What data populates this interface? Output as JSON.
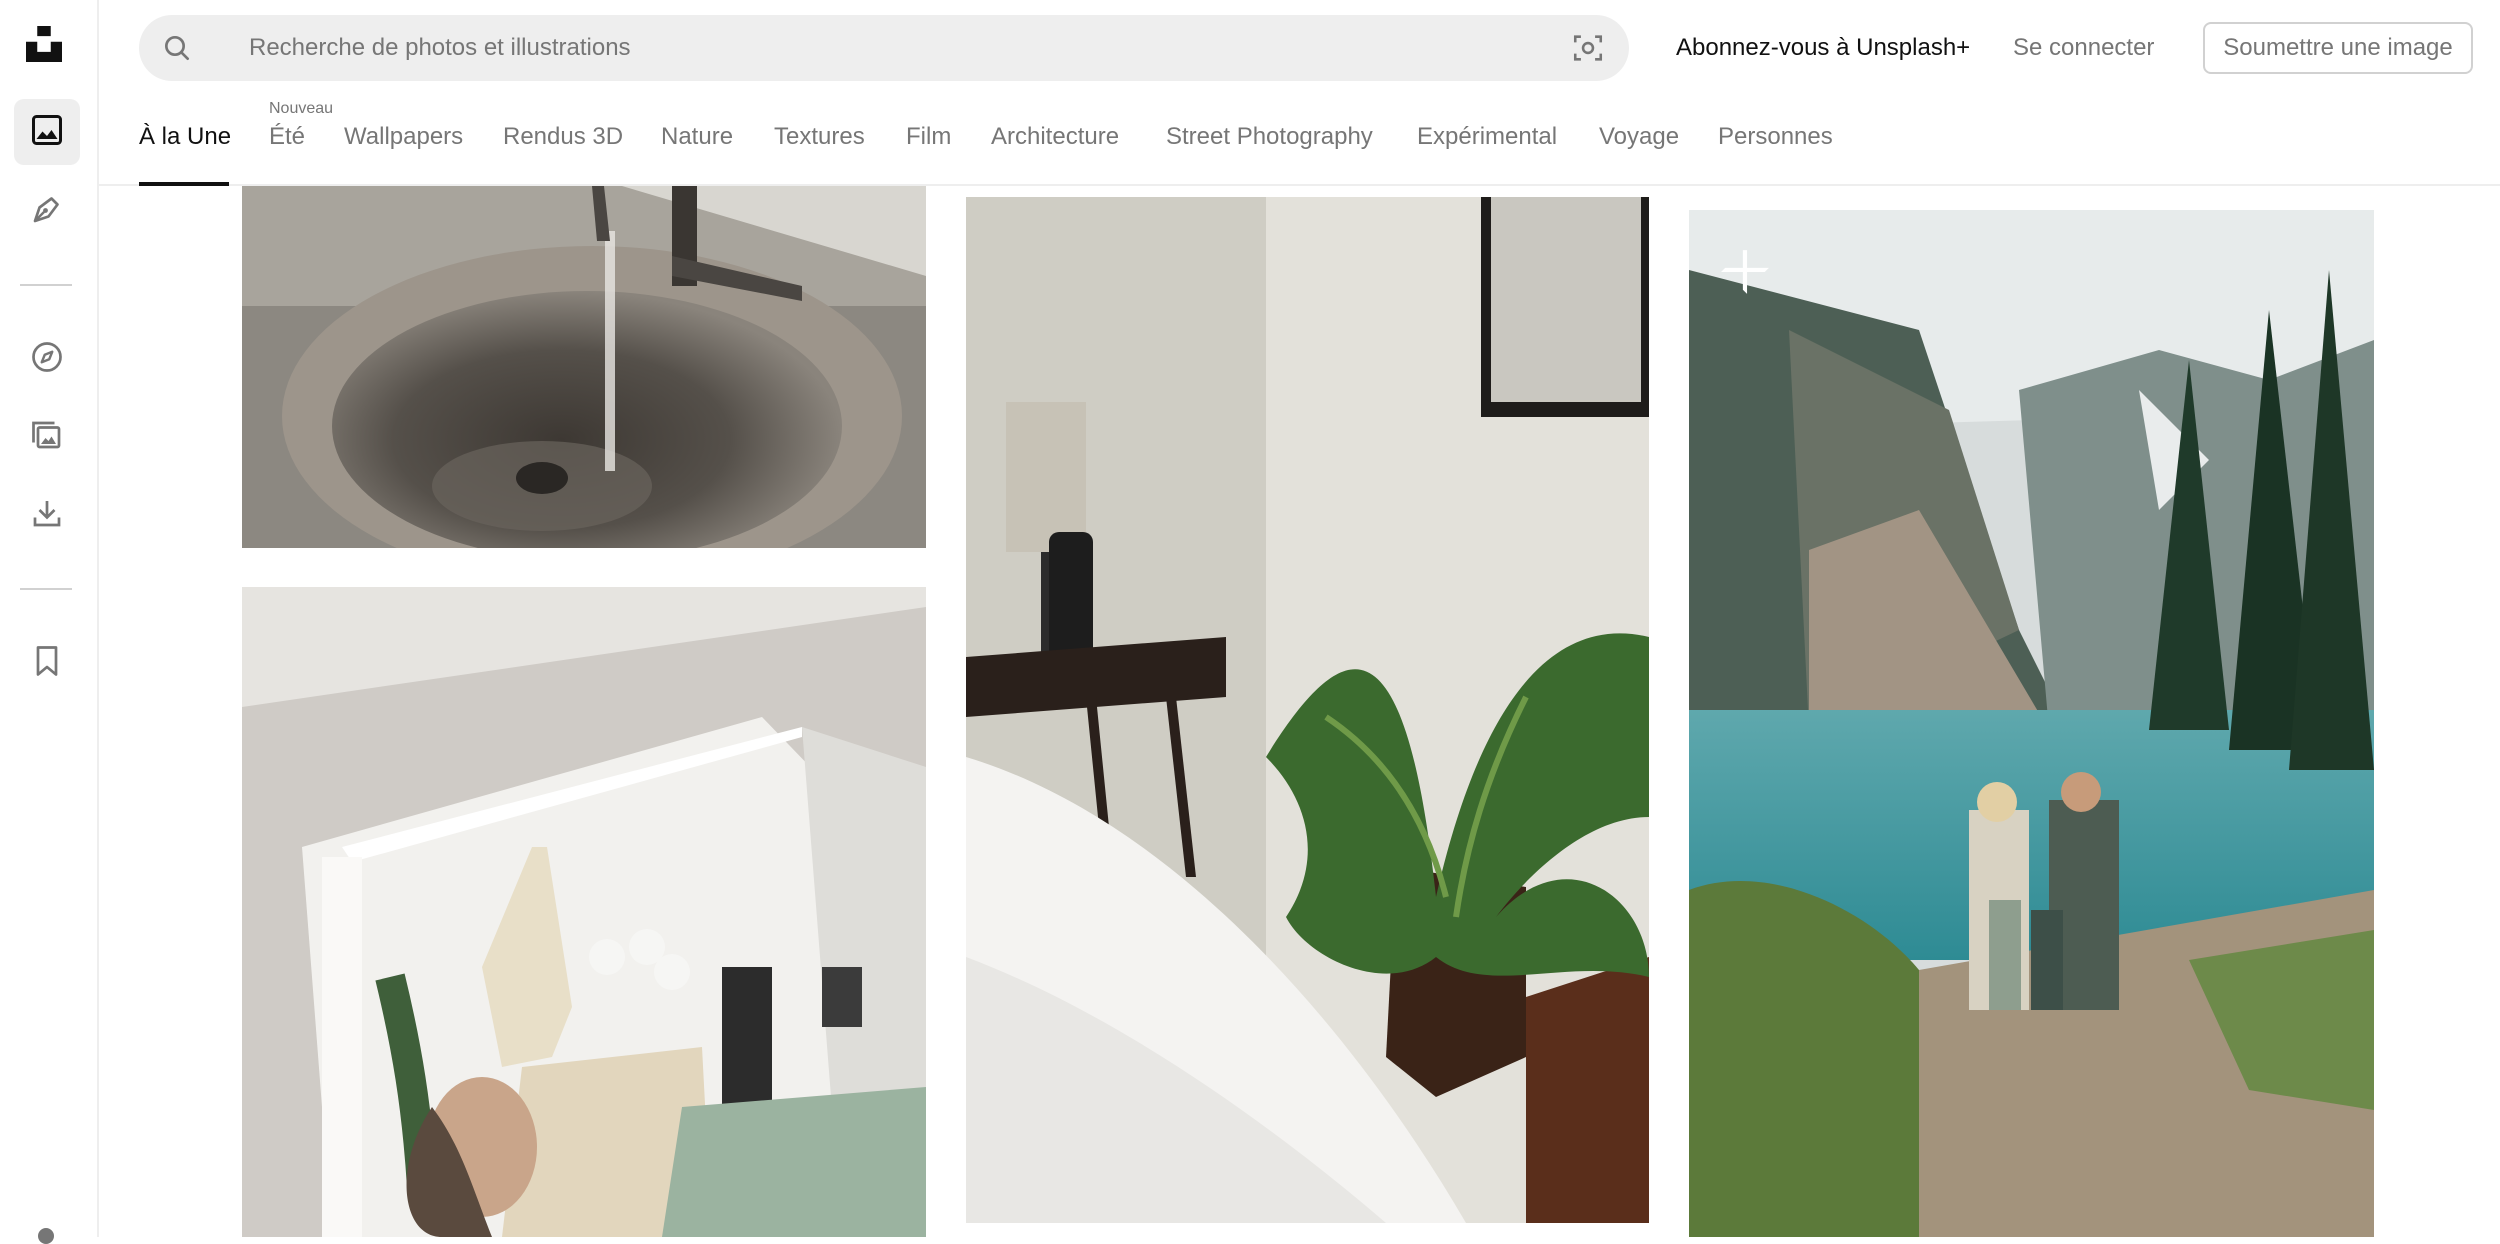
{
  "search": {
    "placeholder": "Recherche de photos et illustrations"
  },
  "header": {
    "plus_link": "Abonnez-vous à Unsplash+",
    "login_link": "Se connecter",
    "submit_button": "Soumettre une image"
  },
  "topics": [
    {
      "label": "À la Une",
      "active": true
    },
    {
      "label": "Été",
      "badge": "Nouveau"
    },
    {
      "label": "Wallpapers"
    },
    {
      "label": "Rendus 3D"
    },
    {
      "label": "Nature"
    },
    {
      "label": "Textures"
    },
    {
      "label": "Film"
    },
    {
      "label": "Architecture"
    },
    {
      "label": "Street Photography"
    },
    {
      "label": "Expérimental"
    },
    {
      "label": "Voyage"
    },
    {
      "label": "Personnes"
    }
  ],
  "rail": {
    "items": [
      {
        "icon": "unsplash-logo-icon"
      },
      {
        "icon": "photos-icon",
        "active": true
      },
      {
        "icon": "illustrations-pen-icon"
      },
      {
        "icon": "explore-compass-icon"
      },
      {
        "icon": "collections-icon"
      },
      {
        "icon": "download-icon"
      },
      {
        "icon": "bookmark-icon"
      }
    ]
  },
  "photos": [
    {
      "subject": "sink-with-running-water"
    },
    {
      "subject": "woman-stretching-in-living-room"
    },
    {
      "subject": "plant-and-lamp-in-corner"
    },
    {
      "subject": "family-at-mountain-lake",
      "badge_icon": "unsplash-plus-icon"
    }
  ],
  "colors": {
    "text_primary": "#111111",
    "text_secondary": "#767676",
    "search_bg": "#eeeeee",
    "border": "#d1d1d1"
  }
}
